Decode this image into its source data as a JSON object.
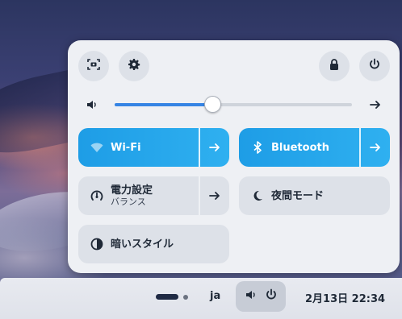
{
  "quick_settings": {
    "buttons": {
      "screenshot": "screenshot-icon",
      "settings": "gear-icon",
      "lock": "lock-icon",
      "power": "power-icon"
    },
    "volume": {
      "icon": "speaker-icon",
      "level": 0.41,
      "next_icon": "arrow-right-icon"
    },
    "tiles": {
      "wifi": {
        "label": "Wi-Fi",
        "active": true
      },
      "bluetooth": {
        "label": "Bluetooth",
        "active": true
      },
      "power_mode": {
        "label": "電力設定",
        "sublabel": "バランス",
        "active": false
      },
      "night_mode": {
        "label": "夜間モード",
        "active": false
      },
      "dark_style": {
        "label": "暗いスタイル",
        "active": false
      }
    },
    "colors": {
      "accent": "#3584e4",
      "tile_active": "#1e9de6"
    }
  },
  "taskbar": {
    "language": "ja",
    "clock": "2月13日  22:34"
  }
}
